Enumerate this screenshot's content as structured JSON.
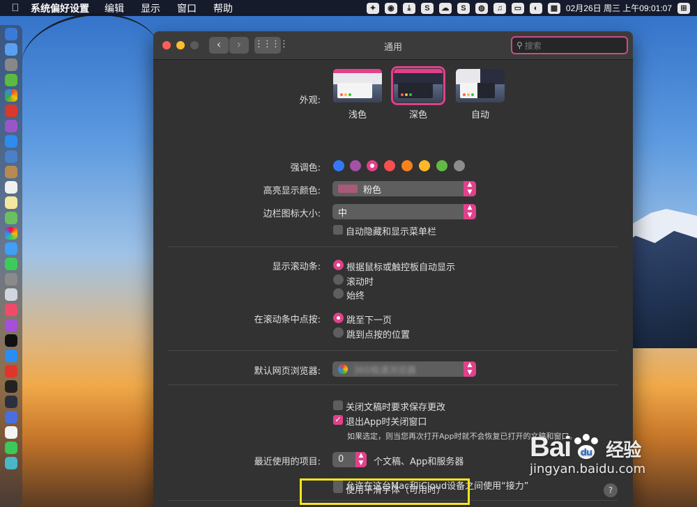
{
  "menubar": {
    "app_name": "系统偏好设置",
    "items": [
      "编辑",
      "显示",
      "窗口",
      "帮助"
    ],
    "clock": "02月26日 周三 上午09:01:07"
  },
  "window": {
    "title": "通用",
    "search_placeholder": "搜索"
  },
  "appearance": {
    "label": "外观:",
    "options": [
      "浅色",
      "深色",
      "自动"
    ],
    "selected": "深色"
  },
  "accent": {
    "label": "强调色:",
    "colors": [
      "#3478f6",
      "#a550a7",
      "#e1418a",
      "#f74f4f",
      "#f7821b",
      "#fcb827",
      "#62ba46",
      "#8c8c8c"
    ],
    "selected_index": 2
  },
  "highlight_color": {
    "label": "高亮显示颜色:",
    "value": "粉色"
  },
  "sidebar_icon_size": {
    "label": "边栏图标大小:",
    "value": "中"
  },
  "auto_hide_menubar": {
    "label": "自动隐藏和显示菜单栏",
    "checked": false
  },
  "show_scrollbars": {
    "label": "显示滚动条:",
    "options": [
      "根据鼠标或触控板自动显示",
      "滚动时",
      "始终"
    ],
    "selected_index": 0
  },
  "click_scrollbar": {
    "label": "在滚动条中点按:",
    "options": [
      "跳至下一页",
      "跳到点按的位置"
    ],
    "selected_index": 0
  },
  "default_browser": {
    "label": "默认网页浏览器:",
    "value": "360极速浏览器"
  },
  "ask_keep_changes": {
    "label": "关闭文稿时要求保存更改",
    "checked": false
  },
  "close_windows": {
    "label": "退出App时关闭窗口",
    "checked": true
  },
  "close_windows_note": "如果选定，则当您再次打开App时就不会恢复已打开的文稿和窗口。",
  "recent_items": {
    "label": "最近使用的项目:",
    "value": "0",
    "suffix": "个文稿、App和服务器"
  },
  "handoff": {
    "label": "允许在这台Mac和iCloud设备之间使用“接力”",
    "checked": false
  },
  "font_smoothing": {
    "label": "使用平滑字体（可用时）",
    "checked": false
  },
  "help_button": "?",
  "watermark": {
    "logo_left": "Bai",
    "logo_right": "经验",
    "url": "jingyan.baidu.com"
  },
  "colors": {
    "accent_pink": "#e1418a",
    "annotation_yellow": "#f5e61c"
  }
}
